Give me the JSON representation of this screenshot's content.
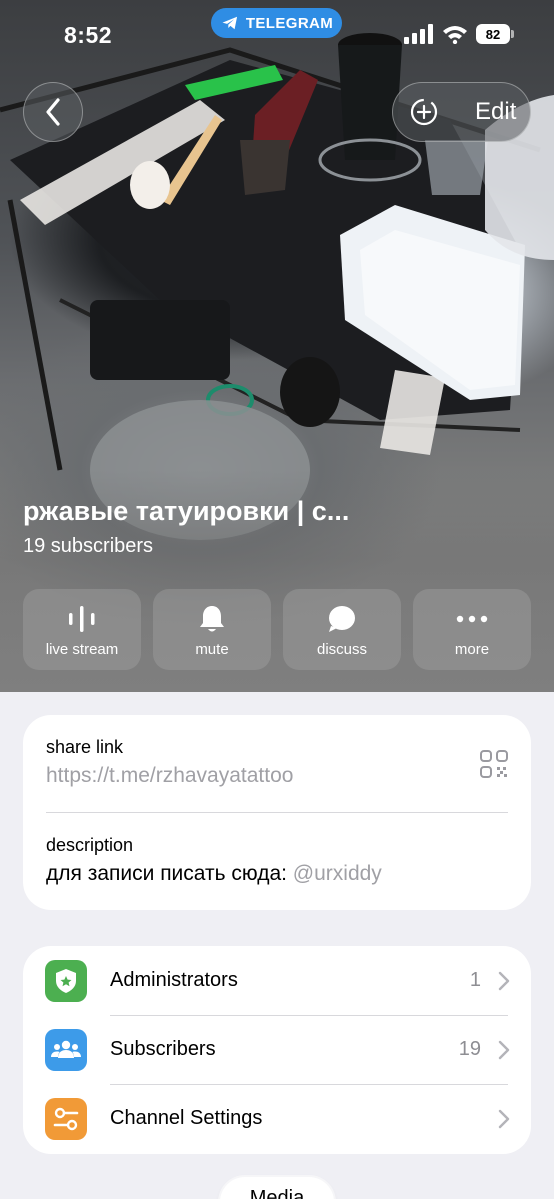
{
  "status_bar": {
    "time": "8:52",
    "app_pill": "TELEGRAM",
    "battery": "82"
  },
  "header": {
    "edit_label": "Edit"
  },
  "channel": {
    "title": "ржавые татуировки | с...",
    "subscribers_line": "19 subscribers"
  },
  "actions": [
    {
      "label": "live stream",
      "icon": "live-stream-icon"
    },
    {
      "label": "mute",
      "icon": "bell-icon"
    },
    {
      "label": "discuss",
      "icon": "chat-bubble-icon"
    },
    {
      "label": "more",
      "icon": "ellipsis-icon"
    }
  ],
  "info": {
    "share_label": "share link",
    "share_value": "https://t.me/rzhavayatattoo",
    "description_label": "description",
    "description_text": "для записи писать сюда: ",
    "description_handle": "@urxiddy"
  },
  "list": [
    {
      "label": "Administrators",
      "value": "1",
      "icon": "shield-star-icon",
      "color": "#4caf50"
    },
    {
      "label": "Subscribers",
      "value": "19",
      "icon": "people-icon",
      "color": "#3d9be9"
    },
    {
      "label": "Channel Settings",
      "value": "",
      "icon": "sliders-icon",
      "color": "#f19a37"
    }
  ],
  "bottom_tab": {
    "label": "Media"
  },
  "colors": {
    "telegram_blue": "#2f8de4",
    "background": "#efeff4",
    "secondary_text": "#a0a0a5"
  }
}
